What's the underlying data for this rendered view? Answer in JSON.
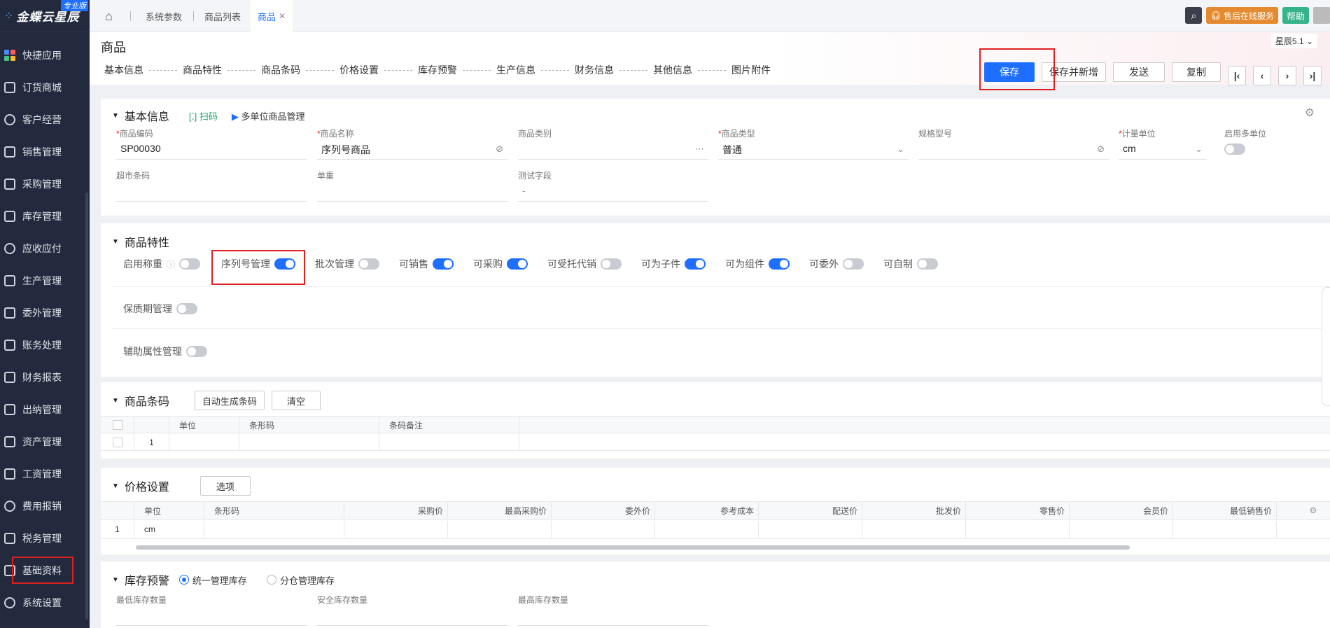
{
  "app": {
    "brand": "金蝶云星辰",
    "edition": "专业版"
  },
  "sidebar": {
    "items": [
      {
        "label": "快捷应用"
      },
      {
        "label": "订货商城"
      },
      {
        "label": "客户经营"
      },
      {
        "label": "销售管理"
      },
      {
        "label": "采购管理"
      },
      {
        "label": "库存管理"
      },
      {
        "label": "应收应付"
      },
      {
        "label": "生产管理"
      },
      {
        "label": "委外管理"
      },
      {
        "label": "账务处理"
      },
      {
        "label": "财务报表"
      },
      {
        "label": "出纳管理"
      },
      {
        "label": "资产管理"
      },
      {
        "label": "工资管理"
      },
      {
        "label": "费用报销"
      },
      {
        "label": "税务管理"
      },
      {
        "label": "基础资料"
      },
      {
        "label": "系统设置"
      }
    ]
  },
  "topbar": {
    "tabs": [
      {
        "label": "系统参数"
      },
      {
        "label": "商品列表"
      },
      {
        "label": "商品"
      }
    ],
    "service": "售后在线服务",
    "help": "帮助",
    "version": "星辰5.1"
  },
  "header": {
    "title": "商品",
    "anchors": [
      "基本信息",
      "商品特性",
      "商品条码",
      "价格设置",
      "库存预警",
      "生产信息",
      "财务信息",
      "其他信息",
      "图片附件"
    ],
    "buttons": {
      "save": "保存",
      "save_new": "保存并新增",
      "send": "发送",
      "copy": "复制"
    }
  },
  "basic": {
    "title": "基本信息",
    "scan": "扫码",
    "multi_unit": "多单位商品管理",
    "fields": {
      "code": {
        "label": "商品编码",
        "value": "SP00030"
      },
      "name": {
        "label": "商品名称",
        "value": "序列号商品"
      },
      "category": {
        "label": "商品类别",
        "value": ""
      },
      "type": {
        "label": "商品类型",
        "value": "普通"
      },
      "spec": {
        "label": "规格型号",
        "value": ""
      },
      "unit": {
        "label": "计量单位",
        "value": "cm"
      },
      "multi_unit": {
        "label": "启用多单位"
      },
      "barcode": {
        "label": "超市条码",
        "value": ""
      },
      "weight": {
        "label": "单重",
        "value": ""
      },
      "test": {
        "label": "测试字段",
        "value": "-"
      }
    }
  },
  "props": {
    "title": "商品特性",
    "items": [
      {
        "label": "启用称重",
        "on": false
      },
      {
        "label": "序列号管理",
        "on": true
      },
      {
        "label": "批次管理",
        "on": false
      },
      {
        "label": "可销售",
        "on": true
      },
      {
        "label": "可采购",
        "on": true
      },
      {
        "label": "可受托代销",
        "on": false
      },
      {
        "label": "可为子件",
        "on": true
      },
      {
        "label": "可为组件",
        "on": true
      },
      {
        "label": "可委外",
        "on": false
      },
      {
        "label": "可自制",
        "on": false
      }
    ],
    "shelf_life": "保质期管理",
    "aux_attr": "辅助属性管理"
  },
  "barcode": {
    "title": "商品条码",
    "auto_btn": "自动生成条码",
    "clear_btn": "清空",
    "columns": [
      "单位",
      "条形码",
      "条码备注"
    ],
    "rows": [
      {
        "no": "1"
      }
    ]
  },
  "price": {
    "title": "价格设置",
    "option_btn": "选项",
    "columns": [
      "单位",
      "条形码",
      "采购价",
      "最高采购价",
      "委外价",
      "参考成本",
      "配送价",
      "批发价",
      "零售价",
      "会员价",
      "最低销售价"
    ],
    "rows": [
      {
        "no": "1",
        "unit": "cm"
      }
    ]
  },
  "stock": {
    "title": "库存预警",
    "opt_unified": "统一管理库存",
    "opt_split": "分仓管理库存",
    "fields": [
      "最低库存数量",
      "安全库存数量",
      "最高库存数量"
    ]
  },
  "colors": {
    "accent": "#1e6fff",
    "sidebar": "#232a3e",
    "highlight": "#e02020"
  }
}
